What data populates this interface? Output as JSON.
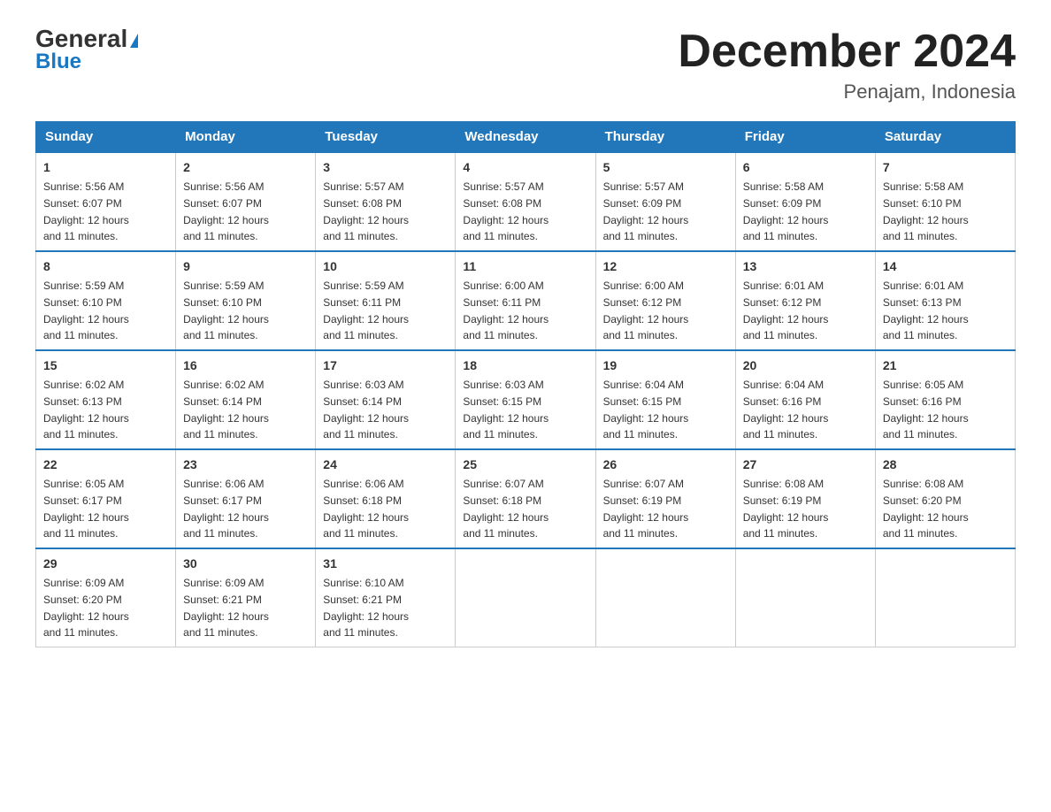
{
  "header": {
    "logo_general": "General",
    "logo_blue": "Blue",
    "title": "December 2024",
    "subtitle": "Penajam, Indonesia"
  },
  "weekdays": [
    "Sunday",
    "Monday",
    "Tuesday",
    "Wednesday",
    "Thursday",
    "Friday",
    "Saturday"
  ],
  "weeks": [
    [
      {
        "day": "1",
        "sunrise": "5:56 AM",
        "sunset": "6:07 PM",
        "daylight": "12 hours and 11 minutes."
      },
      {
        "day": "2",
        "sunrise": "5:56 AM",
        "sunset": "6:07 PM",
        "daylight": "12 hours and 11 minutes."
      },
      {
        "day": "3",
        "sunrise": "5:57 AM",
        "sunset": "6:08 PM",
        "daylight": "12 hours and 11 minutes."
      },
      {
        "day": "4",
        "sunrise": "5:57 AM",
        "sunset": "6:08 PM",
        "daylight": "12 hours and 11 minutes."
      },
      {
        "day": "5",
        "sunrise": "5:57 AM",
        "sunset": "6:09 PM",
        "daylight": "12 hours and 11 minutes."
      },
      {
        "day": "6",
        "sunrise": "5:58 AM",
        "sunset": "6:09 PM",
        "daylight": "12 hours and 11 minutes."
      },
      {
        "day": "7",
        "sunrise": "5:58 AM",
        "sunset": "6:10 PM",
        "daylight": "12 hours and 11 minutes."
      }
    ],
    [
      {
        "day": "8",
        "sunrise": "5:59 AM",
        "sunset": "6:10 PM",
        "daylight": "12 hours and 11 minutes."
      },
      {
        "day": "9",
        "sunrise": "5:59 AM",
        "sunset": "6:10 PM",
        "daylight": "12 hours and 11 minutes."
      },
      {
        "day": "10",
        "sunrise": "5:59 AM",
        "sunset": "6:11 PM",
        "daylight": "12 hours and 11 minutes."
      },
      {
        "day": "11",
        "sunrise": "6:00 AM",
        "sunset": "6:11 PM",
        "daylight": "12 hours and 11 minutes."
      },
      {
        "day": "12",
        "sunrise": "6:00 AM",
        "sunset": "6:12 PM",
        "daylight": "12 hours and 11 minutes."
      },
      {
        "day": "13",
        "sunrise": "6:01 AM",
        "sunset": "6:12 PM",
        "daylight": "12 hours and 11 minutes."
      },
      {
        "day": "14",
        "sunrise": "6:01 AM",
        "sunset": "6:13 PM",
        "daylight": "12 hours and 11 minutes."
      }
    ],
    [
      {
        "day": "15",
        "sunrise": "6:02 AM",
        "sunset": "6:13 PM",
        "daylight": "12 hours and 11 minutes."
      },
      {
        "day": "16",
        "sunrise": "6:02 AM",
        "sunset": "6:14 PM",
        "daylight": "12 hours and 11 minutes."
      },
      {
        "day": "17",
        "sunrise": "6:03 AM",
        "sunset": "6:14 PM",
        "daylight": "12 hours and 11 minutes."
      },
      {
        "day": "18",
        "sunrise": "6:03 AM",
        "sunset": "6:15 PM",
        "daylight": "12 hours and 11 minutes."
      },
      {
        "day": "19",
        "sunrise": "6:04 AM",
        "sunset": "6:15 PM",
        "daylight": "12 hours and 11 minutes."
      },
      {
        "day": "20",
        "sunrise": "6:04 AM",
        "sunset": "6:16 PM",
        "daylight": "12 hours and 11 minutes."
      },
      {
        "day": "21",
        "sunrise": "6:05 AM",
        "sunset": "6:16 PM",
        "daylight": "12 hours and 11 minutes."
      }
    ],
    [
      {
        "day": "22",
        "sunrise": "6:05 AM",
        "sunset": "6:17 PM",
        "daylight": "12 hours and 11 minutes."
      },
      {
        "day": "23",
        "sunrise": "6:06 AM",
        "sunset": "6:17 PM",
        "daylight": "12 hours and 11 minutes."
      },
      {
        "day": "24",
        "sunrise": "6:06 AM",
        "sunset": "6:18 PM",
        "daylight": "12 hours and 11 minutes."
      },
      {
        "day": "25",
        "sunrise": "6:07 AM",
        "sunset": "6:18 PM",
        "daylight": "12 hours and 11 minutes."
      },
      {
        "day": "26",
        "sunrise": "6:07 AM",
        "sunset": "6:19 PM",
        "daylight": "12 hours and 11 minutes."
      },
      {
        "day": "27",
        "sunrise": "6:08 AM",
        "sunset": "6:19 PM",
        "daylight": "12 hours and 11 minutes."
      },
      {
        "day": "28",
        "sunrise": "6:08 AM",
        "sunset": "6:20 PM",
        "daylight": "12 hours and 11 minutes."
      }
    ],
    [
      {
        "day": "29",
        "sunrise": "6:09 AM",
        "sunset": "6:20 PM",
        "daylight": "12 hours and 11 minutes."
      },
      {
        "day": "30",
        "sunrise": "6:09 AM",
        "sunset": "6:21 PM",
        "daylight": "12 hours and 11 minutes."
      },
      {
        "day": "31",
        "sunrise": "6:10 AM",
        "sunset": "6:21 PM",
        "daylight": "12 hours and 11 minutes."
      },
      null,
      null,
      null,
      null
    ]
  ],
  "labels": {
    "sunrise": "Sunrise:",
    "sunset": "Sunset:",
    "daylight": "Daylight:"
  }
}
